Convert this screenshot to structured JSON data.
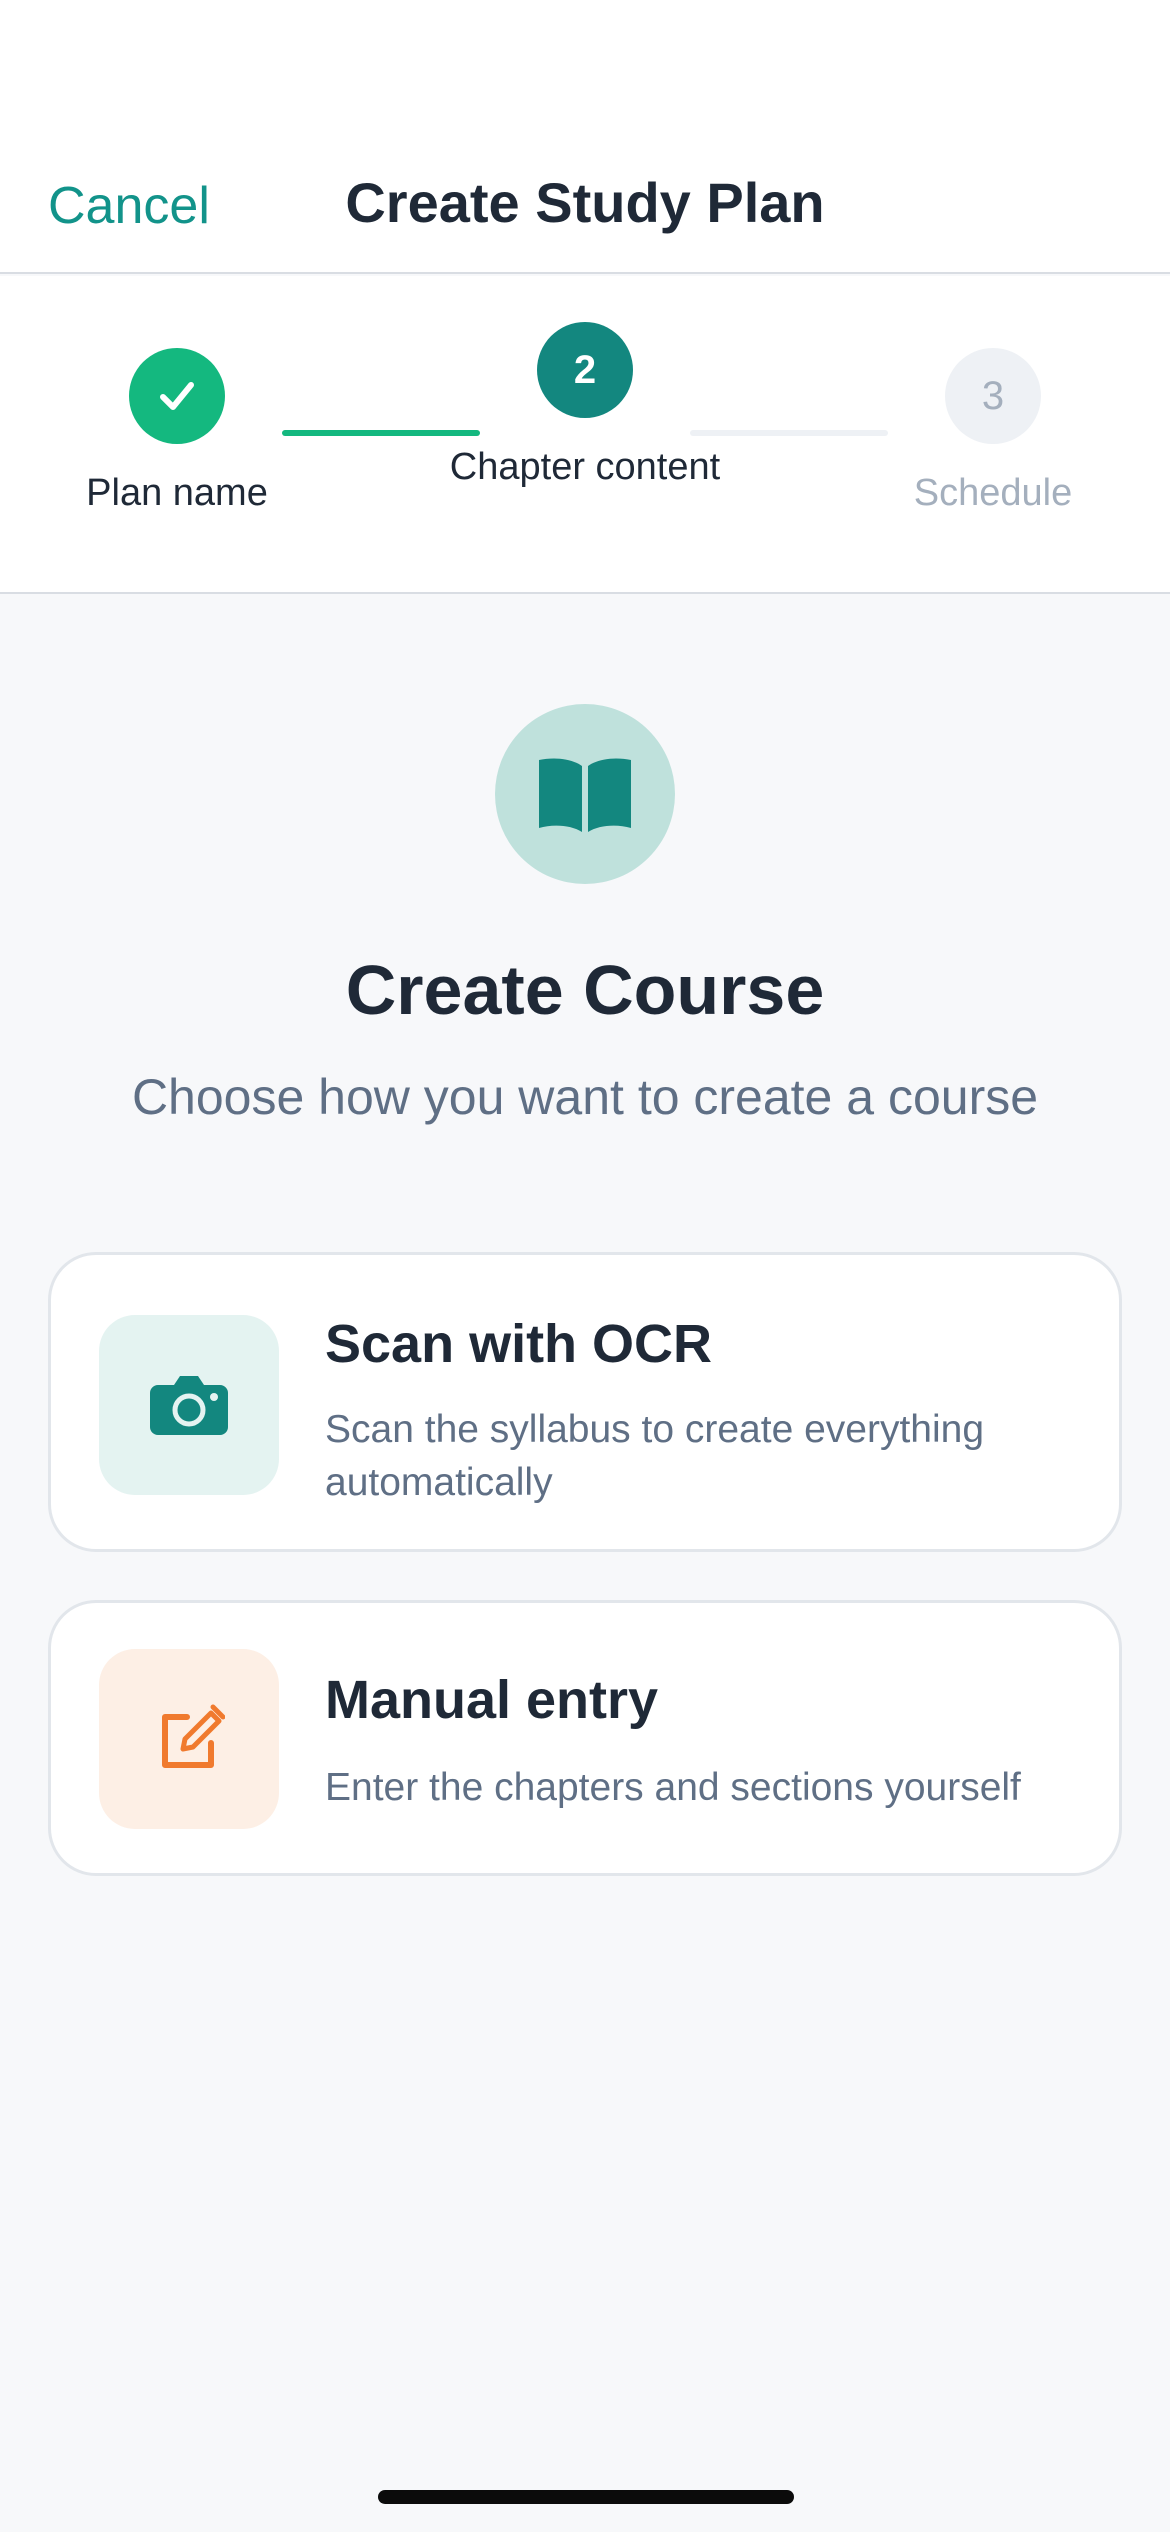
{
  "header": {
    "cancel_label": "Cancel",
    "title": "Create Study Plan"
  },
  "stepper": {
    "steps": [
      {
        "number": "1",
        "label": "Plan name",
        "state": "completed"
      },
      {
        "number": "2",
        "label": "Chapter content",
        "state": "active"
      },
      {
        "number": "3",
        "label": "Schedule",
        "state": "upcoming"
      }
    ]
  },
  "hero": {
    "icon": "book-open-icon",
    "title": "Create Course",
    "subtitle": "Choose how you want to create a course"
  },
  "options": [
    {
      "icon": "camera-icon",
      "title": "Scan with OCR",
      "description": "Scan the syllabus to create everything automatically"
    },
    {
      "icon": "edit-icon",
      "title": "Manual entry",
      "description": "Enter the chapters and sections yourself"
    }
  ],
  "colors": {
    "accent": "#13877f",
    "success": "#14b87f",
    "manual_accent": "#f07a2e"
  }
}
